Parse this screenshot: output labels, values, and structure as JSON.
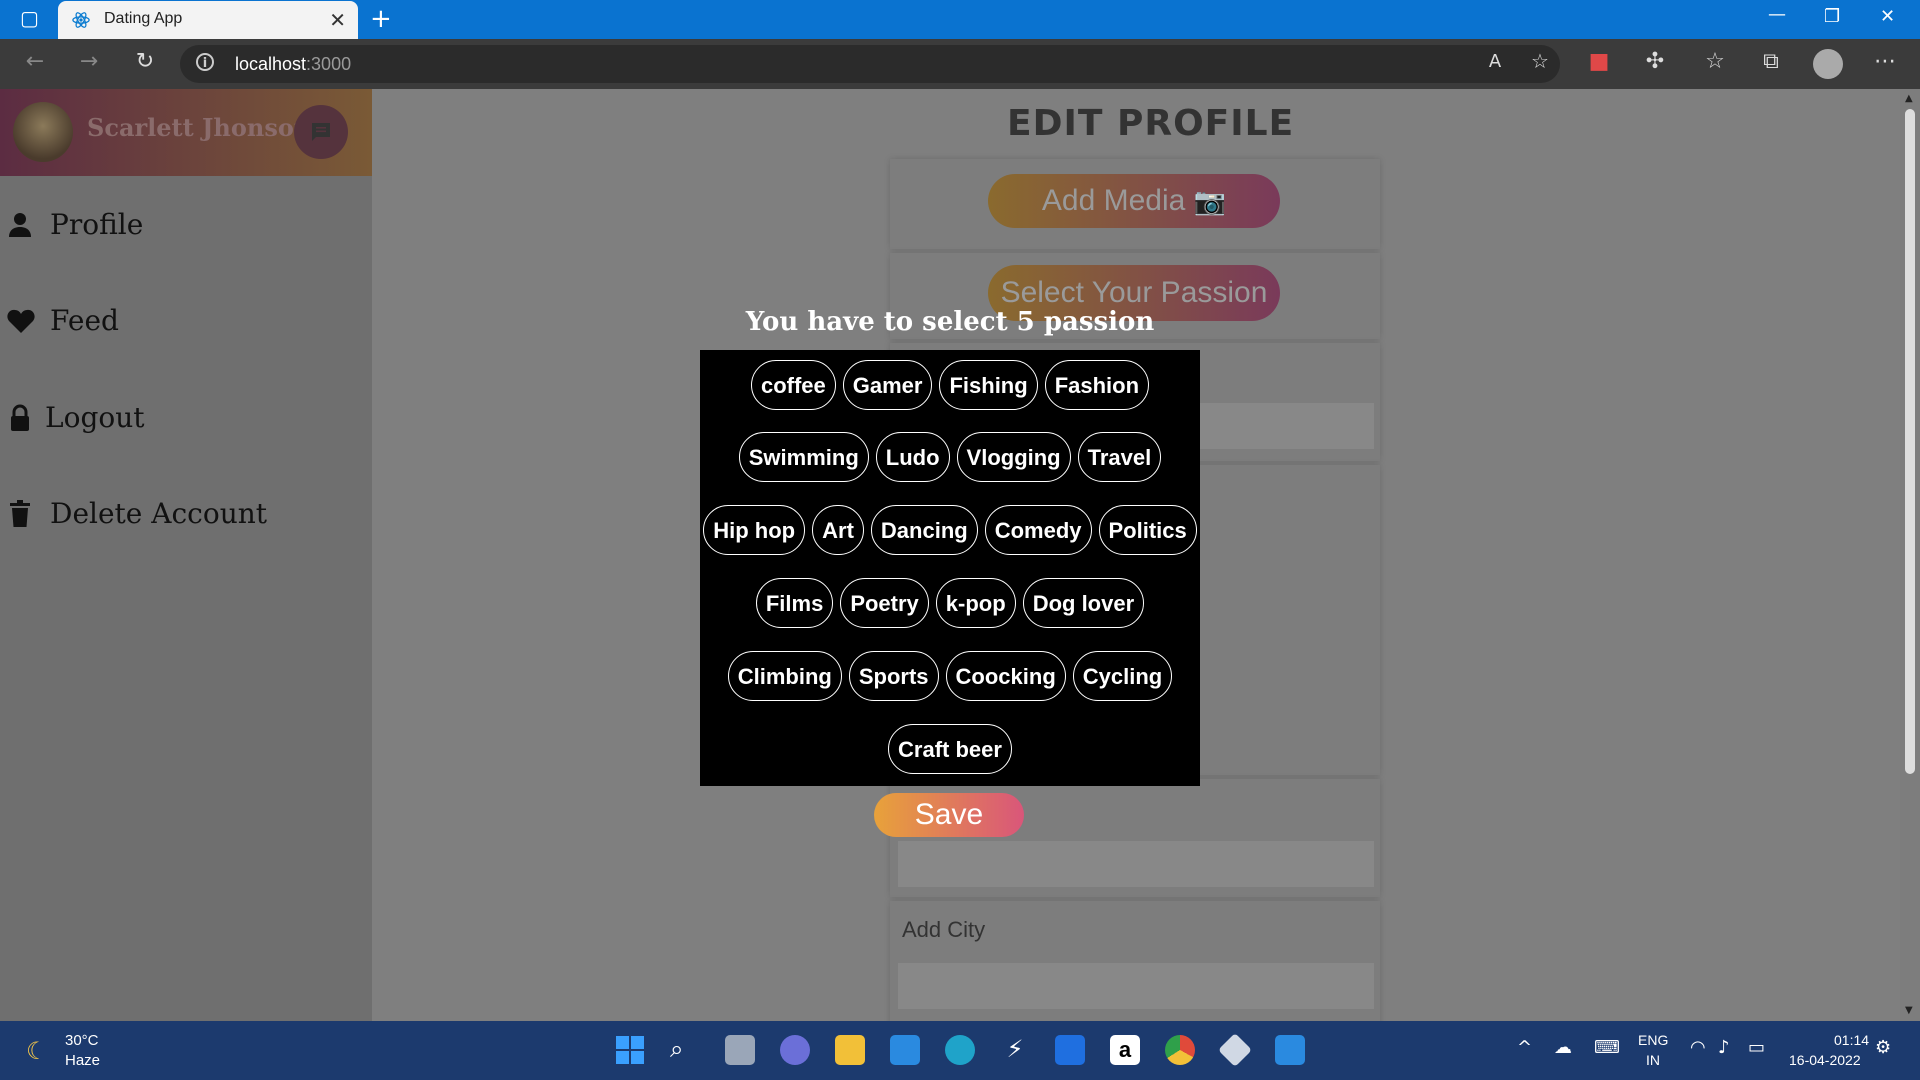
{
  "browser": {
    "tab_title": "Dating App",
    "close_glyph": "✕",
    "new_tab_glyph": "+",
    "url_host": "localhost",
    "url_port": ":3000"
  },
  "sidebar": {
    "user_name": "Scarlett Jhonson",
    "items": [
      {
        "label": "Profile",
        "icon": "user-icon"
      },
      {
        "label": "Feed",
        "icon": "heart-icon"
      },
      {
        "label": "Logout",
        "icon": "lock-icon"
      },
      {
        "label": "Delete Account",
        "icon": "trash-icon"
      }
    ]
  },
  "main": {
    "title": "EDIT PROFILE",
    "add_media_label": "Add Media",
    "select_passion_label": "Select Your Passion",
    "add_city_label": "Add City"
  },
  "modal": {
    "heading": "You have to select 5 passion",
    "rows": [
      [
        "coffee",
        "Gamer",
        "Fishing",
        "Fashion"
      ],
      [
        "Swimming",
        "Ludo",
        "Vlogging",
        "Travel"
      ],
      [
        "Hip hop",
        "Art",
        "Dancing",
        "Comedy",
        "Politics"
      ],
      [
        "Films",
        "Poetry",
        "k-pop",
        "Dog lover"
      ],
      [
        "Climbing",
        "Sports",
        "Coocking",
        "Cycling"
      ],
      [
        "Craft beer"
      ]
    ],
    "save_label": "Save"
  },
  "taskbar": {
    "weather_temp": "30°C",
    "weather_desc": "Haze",
    "lang_line1": "ENG",
    "lang_line2": "IN",
    "time": "01:14",
    "date": "16-04-2022"
  },
  "colors": {
    "titlebar": "#0a73d0",
    "taskbar": "#1c3a6e",
    "modal_bg": "#000000",
    "save_gradient_start": "#e8a23a",
    "save_gradient_end": "#d9567a"
  }
}
